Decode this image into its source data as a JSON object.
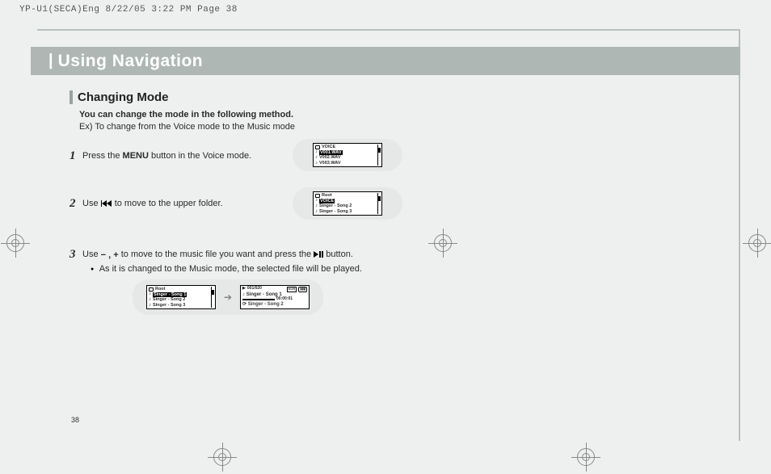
{
  "header_meta": "YP-U1(SECA)Eng  8/22/05 3:22 PM  Page 38",
  "title": "Using Navigation",
  "section_title": "Changing Mode",
  "section_note_bold": "You can change the mode in the following method.",
  "section_note_ex": "Ex) To change from the Voice mode to the Music mode",
  "step1": {
    "num": "1",
    "pre": "Press the ",
    "bold": "MENU",
    "post": " button in the Voice mode."
  },
  "step2": {
    "num": "2",
    "pre": "Use ",
    "post": " to move to the upper folder."
  },
  "step3": {
    "num": "3",
    "pre": "Use ",
    "mid": " to move to the music file you want and press the ",
    "post": " button.",
    "bullet": "As it is changed to the Music mode, the selected file will be played."
  },
  "lcd1": {
    "header": "VOICE",
    "rows": [
      "V001.WAV",
      "V002.WAV",
      "V003.WAV"
    ]
  },
  "lcd2": {
    "header": "Root",
    "rows": [
      "VOICE",
      "Singer - Song 2",
      "Singer - Song 3"
    ]
  },
  "lcd3a": {
    "header": "Root",
    "rows": [
      "Singer - Song 1",
      "Singer - Song 2",
      "Singer - Song 3"
    ]
  },
  "lcd3b": {
    "counter": "001/020",
    "row1": "Singer - Song 1",
    "time": "00:00:01",
    "row2": "Singer - Song 2"
  },
  "minus_plus": "− , +",
  "page_number": "38"
}
